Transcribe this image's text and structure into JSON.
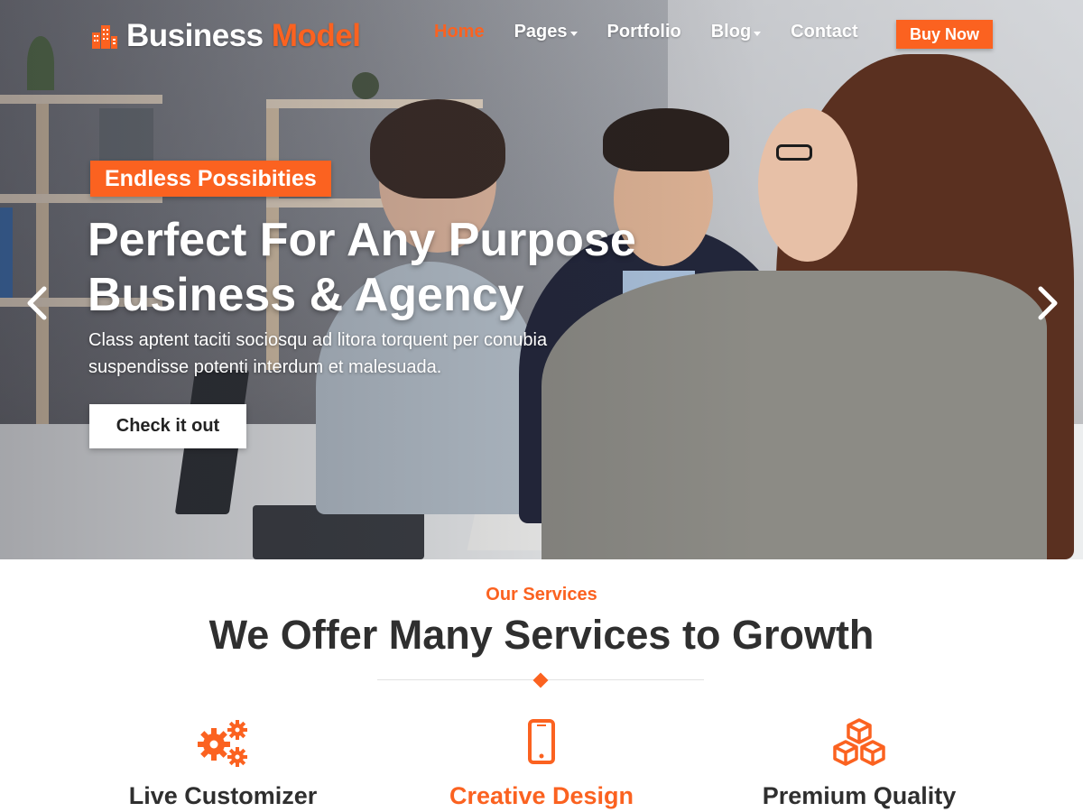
{
  "brand": {
    "name_primary": "Business",
    "name_accent": "Model"
  },
  "nav": {
    "items": [
      {
        "label": "Home",
        "active": true,
        "has_dropdown": false
      },
      {
        "label": "Pages",
        "active": false,
        "has_dropdown": true
      },
      {
        "label": "Portfolio",
        "active": false,
        "has_dropdown": false
      },
      {
        "label": "Blog",
        "active": false,
        "has_dropdown": true
      },
      {
        "label": "Contact",
        "active": false,
        "has_dropdown": false
      }
    ],
    "buy_label": "Buy Now"
  },
  "hero": {
    "tagline": "Endless Possibities",
    "title_line1": "Perfect For Any Purpose",
    "title_line2": "Business & Agency",
    "description_line1": "Class aptent taciti sociosqu ad litora torquent per conubia",
    "description_line2": "suspendisse potenti interdum et malesuada.",
    "cta_label": "Check it out",
    "prev_icon": "chevron-left-icon",
    "next_icon": "chevron-right-icon"
  },
  "services": {
    "kicker": "Our Services",
    "title": "We Offer Many Services to Growth",
    "items": [
      {
        "label": "Live Customizer",
        "icon": "gears-icon",
        "highlighted": false
      },
      {
        "label": "Creative Design",
        "icon": "mobile-phone-icon",
        "highlighted": true
      },
      {
        "label": "Premium Quality",
        "icon": "cubes-icon",
        "highlighted": false
      }
    ]
  },
  "colors": {
    "accent": "#fb6220",
    "heading": "#2f2f2f",
    "white": "#ffffff"
  }
}
